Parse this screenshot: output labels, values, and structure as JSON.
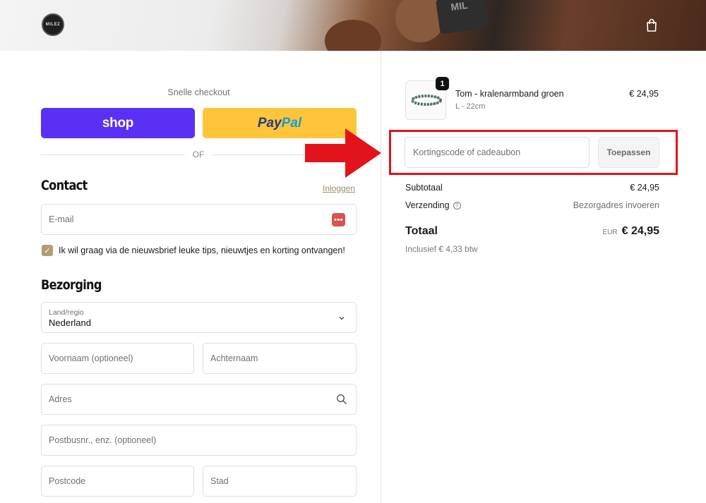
{
  "header": {
    "logo_text": "MILEZ",
    "banner_text": "MIL",
    "cart_icon": "shopping-bag-icon"
  },
  "express": {
    "title": "Snelle checkout",
    "shop_label": "shop",
    "paypal_label_part1": "Pay",
    "paypal_label_part2": "Pal",
    "divider_text": "OF"
  },
  "contact": {
    "title": "Contact",
    "login_link": "Inloggen",
    "email_placeholder": "E-mail",
    "email_icon_text": "•••",
    "newsletter_label": "Ik wil graag via de nieuwsbrief leuke tips, nieuwtjes en korting ontvangen!",
    "newsletter_checked": true
  },
  "delivery": {
    "title": "Bezorging",
    "country_label": "Land/regio",
    "country_value": "Nederland",
    "first_name_placeholder": "Voornaam (optioneel)",
    "last_name_placeholder": "Achternaam",
    "address_placeholder": "Adres",
    "address2_placeholder": "Postbusnr., enz. (optioneel)",
    "postcode_placeholder": "Postcode",
    "city_placeholder": "Stad"
  },
  "order": {
    "item": {
      "quantity": "1",
      "name": "Tom - kralenarmband groen",
      "variant": "L - 22cm",
      "price": "€ 24,95"
    },
    "discount": {
      "placeholder": "Kortingscode of cadeaubon",
      "apply_label": "Toepassen"
    },
    "subtotal_label": "Subtotaal",
    "subtotal_value": "€ 24,95",
    "shipping_label": "Verzending",
    "shipping_value": "Bezorgadres invoeren",
    "total_label": "Totaal",
    "total_currency": "EUR",
    "total_value": "€ 24,95",
    "vat_note": "Inclusief € 4,33 btw"
  },
  "colors": {
    "shop_purple": "#5a31f4",
    "paypal_yellow": "#ffc439",
    "highlight_red": "#e3131b",
    "accent_tan": "#b39b7c"
  }
}
